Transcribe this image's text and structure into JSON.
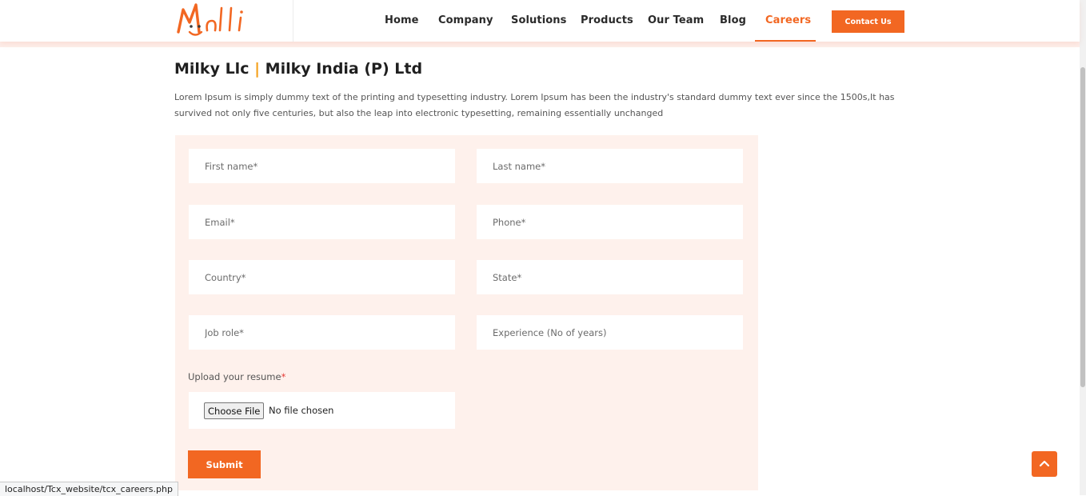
{
  "brand": {
    "logo_text": "Malli",
    "accent_color": "#f26722",
    "highlight_color": "#f5a01a"
  },
  "nav": {
    "items": [
      {
        "label": "Home"
      },
      {
        "label": "Company"
      },
      {
        "label": "Solutions"
      },
      {
        "label": "Products"
      },
      {
        "label": "Our Team"
      },
      {
        "label": "Blog"
      },
      {
        "label": "Careers",
        "active": true
      }
    ],
    "contact_label": "Contact Us"
  },
  "page": {
    "heading_part1": "Milky Llc",
    "heading_separator": "|",
    "heading_part2": "Milky India (P) Ltd",
    "description": "Lorem Ipsum is simply dummy text of the printing and typesetting industry. Lorem Ipsum has been the industry's standard dummy text ever since the 1500s,It has survived not only five centuries, but also the leap into electronic typesetting, remaining essentially unchanged"
  },
  "form": {
    "first_name": {
      "placeholder": "First name*",
      "value": ""
    },
    "last_name": {
      "placeholder": "Last name*",
      "value": ""
    },
    "email": {
      "placeholder": "Email*",
      "value": ""
    },
    "phone": {
      "placeholder": "Phone*",
      "value": ""
    },
    "country": {
      "placeholder": "Country*",
      "value": ""
    },
    "state": {
      "placeholder": "State*",
      "value": ""
    },
    "job_role": {
      "placeholder": "Job role*",
      "value": ""
    },
    "experience": {
      "placeholder": "Experience (No of years)",
      "value": ""
    },
    "upload_label": "Upload your resume",
    "upload_required_mark": "*",
    "choose_file_label": "Choose File",
    "no_file_text": "No file chosen",
    "submit_label": "Submit"
  },
  "icons": {
    "back_to_top": "chevron-up-icon"
  },
  "status_bar": {
    "url": "localhost/Tcx_website/tcx_careers.php"
  }
}
